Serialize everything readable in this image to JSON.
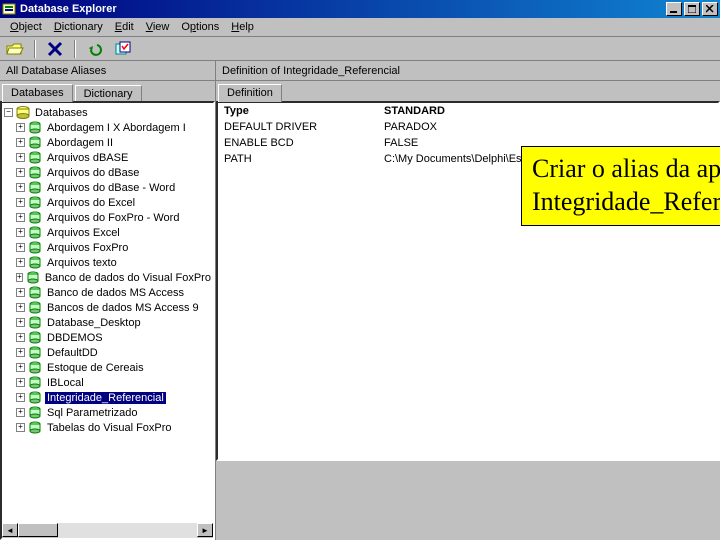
{
  "window": {
    "title": "Database Explorer"
  },
  "menu": {
    "items": [
      {
        "label": "Object",
        "u": "O"
      },
      {
        "label": "Dictionary",
        "u": "D"
      },
      {
        "label": "Edit",
        "u": "E"
      },
      {
        "label": "View",
        "u": "V"
      },
      {
        "label": "Options",
        "u": "p"
      },
      {
        "label": "Help",
        "u": "H"
      }
    ]
  },
  "labels": {
    "left": "All Database Aliases",
    "right": "Definition of Integridade_Referencial"
  },
  "left_tabs": {
    "active": "Databases",
    "inactive": "Dictionary"
  },
  "right_tabs": {
    "active": "Definition"
  },
  "tree": {
    "root": "Databases",
    "items": [
      {
        "label": "Abordagem I X Abordagem I"
      },
      {
        "label": "Abordagem II"
      },
      {
        "label": "Arquivos dBASE"
      },
      {
        "label": "Arquivos do dBase"
      },
      {
        "label": "Arquivos do dBase - Word"
      },
      {
        "label": "Arquivos do Excel"
      },
      {
        "label": "Arquivos do FoxPro - Word"
      },
      {
        "label": "Arquivos Excel"
      },
      {
        "label": "Arquivos FoxPro"
      },
      {
        "label": "Arquivos texto"
      },
      {
        "label": "Banco de dados do Visual FoxPro"
      },
      {
        "label": "Banco de dados MS Access"
      },
      {
        "label": "Bancos de dados MS Access 9"
      },
      {
        "label": "Database_Desktop"
      },
      {
        "label": "DBDEMOS"
      },
      {
        "label": "DefaultDD"
      },
      {
        "label": "Estoque de Cereais"
      },
      {
        "label": "IBLocal"
      },
      {
        "label": "Integridade_Referencial",
        "selected": true
      },
      {
        "label": "Sql Parametrizado"
      },
      {
        "label": "Tabelas do Visual FoxPro"
      }
    ]
  },
  "definition": {
    "header_col1": "Type",
    "rows": [
      {
        "k": "",
        "v": "STANDARD"
      },
      {
        "k": "DEFAULT DRIVER",
        "v": "PARADOX"
      },
      {
        "k": "ENABLE BCD",
        "v": "FALSE"
      },
      {
        "k": "PATH",
        "v": "C:\\My Documents\\Delphi\\Estudo de Casos\\Integridade Referencial"
      }
    ]
  },
  "callout": {
    "line1": "Criar o alias da aplicação:",
    "line2": "Integridade_Referencial"
  }
}
